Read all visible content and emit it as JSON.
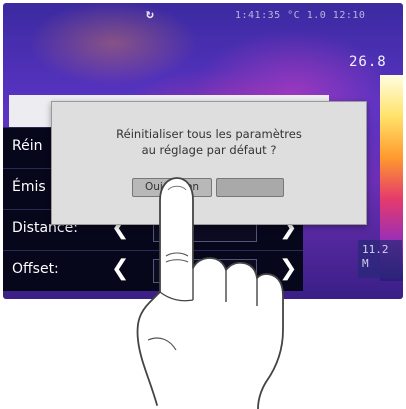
{
  "status_bar": {
    "icon": "refresh-icon",
    "text": "1:41:35  °C  1.0  12:10"
  },
  "scale": {
    "max_value": "26.8",
    "min_value": "11.2\nM"
  },
  "menu": {
    "rows": [
      {
        "label": "Réin"
      },
      {
        "label": "Émis"
      },
      {
        "label": "Distance:"
      },
      {
        "label": "Offset:"
      }
    ]
  },
  "dialog": {
    "line1": "Réinitialiser tous les paramètres",
    "line2": "au réglage par défaut ?",
    "ok_label": "Oui Action",
    "cancel_label": ""
  },
  "colors": {
    "dialog_bg": "#dedede",
    "menu_row_bg": "#07071c",
    "thermal_base": "#5a34c4"
  }
}
